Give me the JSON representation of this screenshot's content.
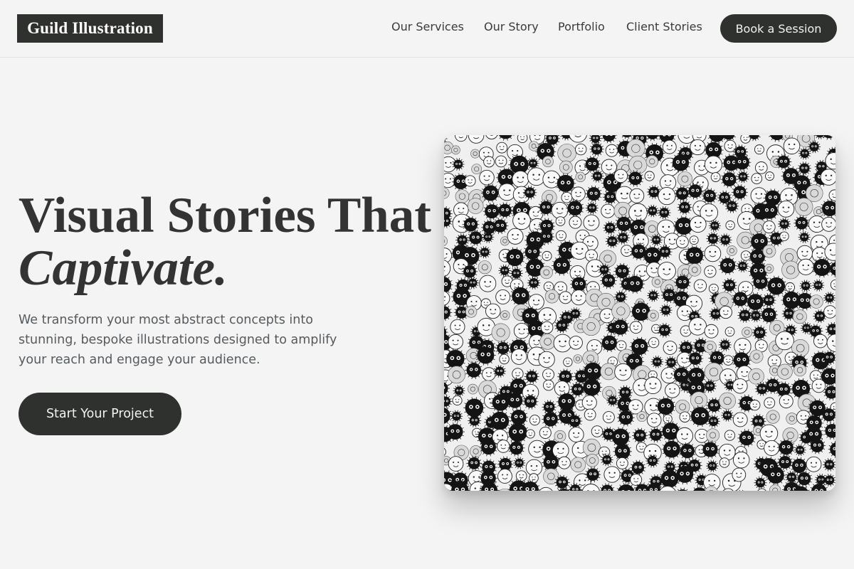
{
  "header": {
    "logo": "Guild Illustration",
    "nav": [
      {
        "label": "Our Services"
      },
      {
        "label": "Our Story"
      },
      {
        "label": "Portfolio"
      },
      {
        "label": "Client Stories"
      }
    ],
    "cta_label": "Book a Session"
  },
  "hero": {
    "title_line1": "Visual Stories That",
    "title_line2": "Captivate.",
    "subtitle": "We transform your most abstract concepts into stunning, bespoke illustrations designed to amplify your reach and engage your audience.",
    "cta_label": "Start Your Project",
    "image_icon": "doodle-collage-illustration"
  },
  "colors": {
    "background": "#f4f4f4",
    "dark_button": "#2f312e",
    "text": "#333333",
    "subtext": "#555a5e"
  }
}
